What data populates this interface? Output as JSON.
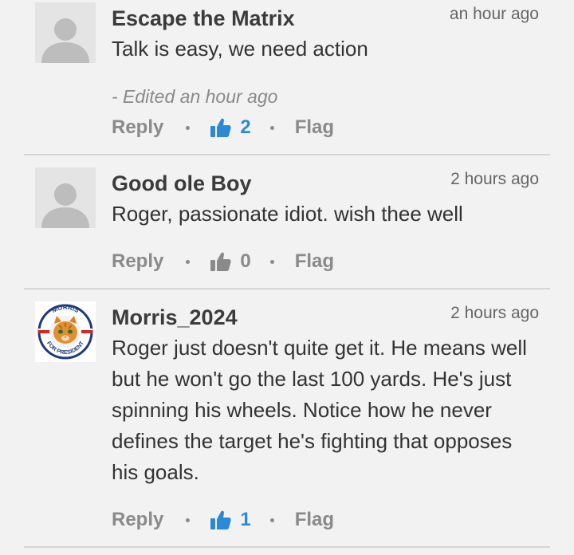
{
  "comments": [
    {
      "author": "Escape the Matrix",
      "time": "an hour ago",
      "body": "Talk is easy, we need action",
      "edited": "- Edited an hour ago",
      "reply_label": "Reply",
      "like_count": "2",
      "liked": true,
      "flag_label": "Flag",
      "avatar_icon": "default-user-icon"
    },
    {
      "author": "Good ole Boy",
      "time": "2 hours ago",
      "body": "Roger, passionate idiot. wish thee well",
      "reply_label": "Reply",
      "like_count": "0",
      "liked": false,
      "flag_label": "Flag",
      "avatar_icon": "default-user-icon"
    },
    {
      "author": "Morris_2024",
      "time": "2 hours ago",
      "body": "Roger just doesn't quite get it. He means well but he won't go the last 100 yards. He's just spinning his wheels. Notice how he never defines the target he's fighting that opposes his goals.",
      "reply_label": "Reply",
      "like_count": "1",
      "liked": true,
      "flag_label": "Flag",
      "avatar_icon": "morris-cat-badge-icon",
      "avatar_text_top": "MORRIS",
      "avatar_text_bottom": "FOR PRESIDENT"
    }
  ],
  "colors": {
    "background": "#f2f2f2",
    "like_active": "#2b8ad6",
    "muted": "#8a8a8a",
    "divider": "#d6d6d6"
  }
}
